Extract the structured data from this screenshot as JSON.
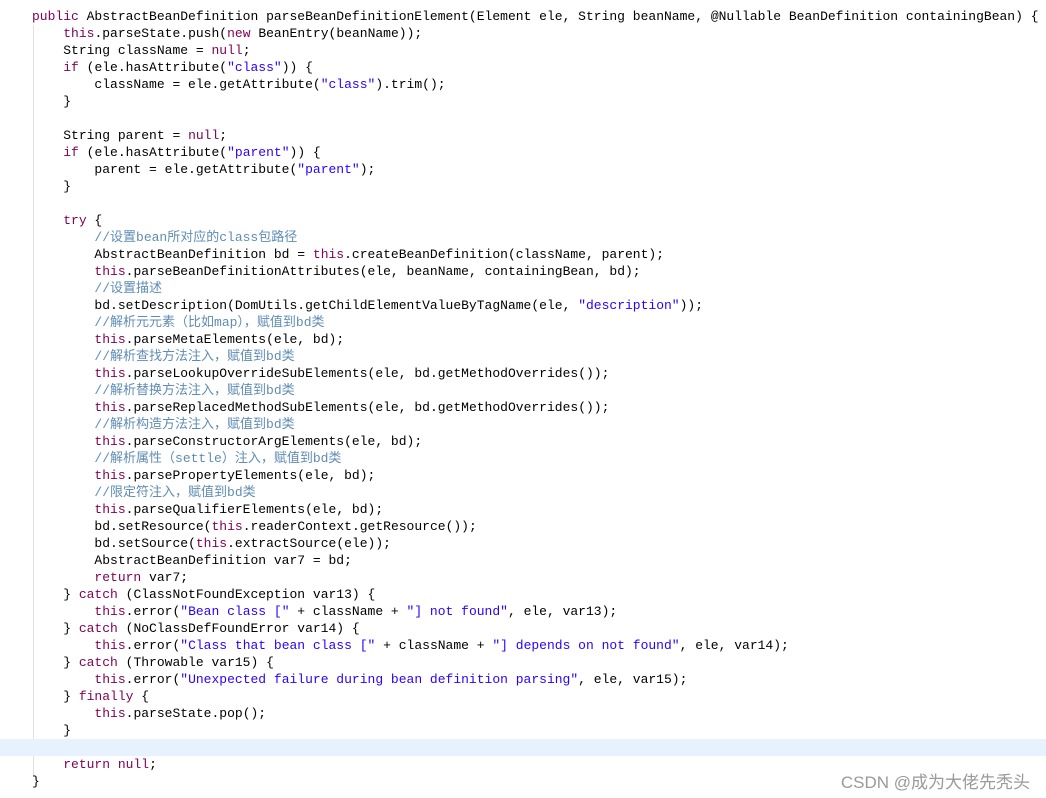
{
  "editor": {
    "current_line": 44,
    "colors": {
      "keyword": "#7f0055",
      "string": "#2a00ff",
      "comment": "#5f8cb4",
      "current_line_bg": "#e8f2fe"
    },
    "keywords": [
      "public",
      "new",
      "null",
      "if",
      "try",
      "this",
      "return",
      "catch",
      "finally"
    ],
    "lines": [
      "public AbstractBeanDefinition parseBeanDefinitionElement(Element ele, String beanName, @Nullable BeanDefinition containingBean) {",
      "    this.parseState.push(new BeanEntry(beanName));",
      "    String className = null;",
      "    if (ele.hasAttribute(\"class\")) {",
      "        className = ele.getAttribute(\"class\").trim();",
      "    }",
      "",
      "    String parent = null;",
      "    if (ele.hasAttribute(\"parent\")) {",
      "        parent = ele.getAttribute(\"parent\");",
      "    }",
      "",
      "    try {",
      "        //设置bean所对应的class包路径",
      "        AbstractBeanDefinition bd = this.createBeanDefinition(className, parent);",
      "        this.parseBeanDefinitionAttributes(ele, beanName, containingBean, bd);",
      "        //设置描述",
      "        bd.setDescription(DomUtils.getChildElementValueByTagName(ele, \"description\"));",
      "        //解析元元素（比如map），赋值到bd类",
      "        this.parseMetaElements(ele, bd);",
      "        //解析查找方法注入，赋值到bd类",
      "        this.parseLookupOverrideSubElements(ele, bd.getMethodOverrides());",
      "        //解析替换方法注入，赋值到bd类",
      "        this.parseReplacedMethodSubElements(ele, bd.getMethodOverrides());",
      "        //解析构造方法注入，赋值到bd类",
      "        this.parseConstructorArgElements(ele, bd);",
      "        //解析属性（settle）注入，赋值到bd类",
      "        this.parsePropertyElements(ele, bd);",
      "        //限定符注入，赋值到bd类",
      "        this.parseQualifierElements(ele, bd);",
      "        bd.setResource(this.readerContext.getResource());",
      "        bd.setSource(this.extractSource(ele));",
      "        AbstractBeanDefinition var7 = bd;",
      "        return var7;",
      "    } catch (ClassNotFoundException var13) {",
      "        this.error(\"Bean class [\" + className + \"] not found\", ele, var13);",
      "    } catch (NoClassDefFoundError var14) {",
      "        this.error(\"Class that bean class [\" + className + \"] depends on not found\", ele, var14);",
      "    } catch (Throwable var15) {",
      "        this.error(\"Unexpected failure during bean definition parsing\", ele, var15);",
      "    } finally {",
      "        this.parseState.pop();",
      "    }",
      "",
      "    return null;",
      "}"
    ]
  },
  "watermark": "CSDN @成为大佬先秃头"
}
